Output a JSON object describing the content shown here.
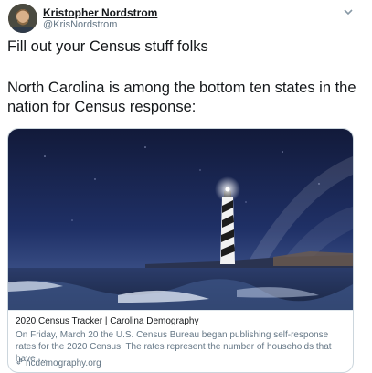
{
  "tweet": {
    "author_name": "Kristopher Nordstrom",
    "author_handle": "@KrisNordstrom",
    "line1": "Fill out your Census stuff folks",
    "line2": "North Carolina is among the bottom ten states in the nation for Census response:"
  },
  "card": {
    "title": "2020 Census Tracker | Carolina Demography",
    "description": "On Friday, March 20 the U.S. Census Bureau began publishing self-response rates for the 2020 Census. The rates represent the number of households that have …",
    "link": "ncdemography.org"
  },
  "icons": {
    "more": "chevron-down-icon",
    "link": "link-icon"
  },
  "colors": {
    "text": "#14171a",
    "secondary": "#657786",
    "border": "#ccd6dd"
  }
}
